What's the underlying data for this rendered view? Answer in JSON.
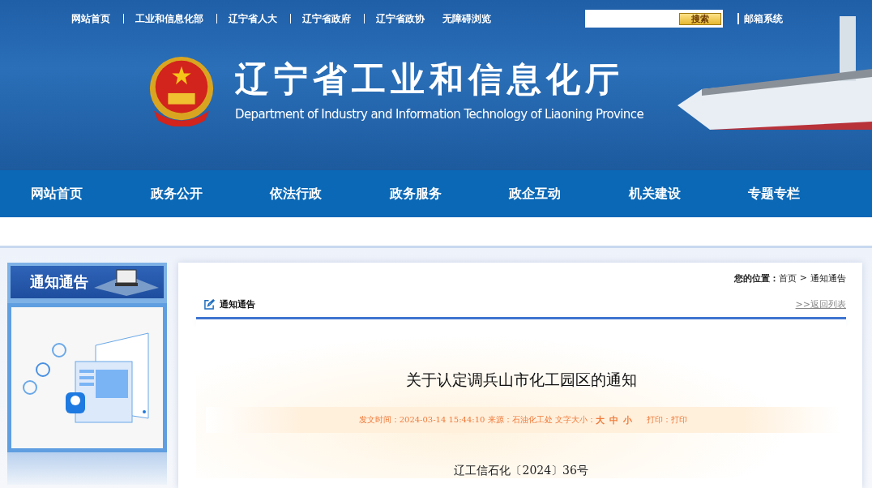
{
  "top_links": [
    "网站首页",
    "工业和信息化部",
    "辽宁省人大",
    "辽宁省政府",
    "辽宁省政协",
    "无障碍浏览"
  ],
  "search": {
    "button": "搜索"
  },
  "mail_link": "邮箱系统",
  "site": {
    "title": "辽宁省工业和信息化厅",
    "subtitle": "Department of Industry and Information Technology of Liaoning Province"
  },
  "nav": [
    "网站首页",
    "政务公开",
    "依法行政",
    "政务服务",
    "政企互动",
    "机关建设",
    "专题专栏"
  ],
  "sidebar": {
    "title": "通知通告"
  },
  "content": {
    "section_title": "通知通告",
    "breadcrumb_label": "您的位置：",
    "breadcrumb": [
      "首页",
      "通知通告"
    ],
    "breadcrumb_separator": ">",
    "back_link": ">>返回列表",
    "article_title": "关于认定调兵山市化工园区的通知",
    "meta": {
      "info": "发文时间：2024-03-14 15:44:10 来源：石油化工处 文字大小：",
      "font_sizes": [
        "大",
        "中",
        "小"
      ],
      "print_label": "打印：",
      "print_link": "打印"
    },
    "doc_number": "辽工信石化〔2024〕36号"
  }
}
